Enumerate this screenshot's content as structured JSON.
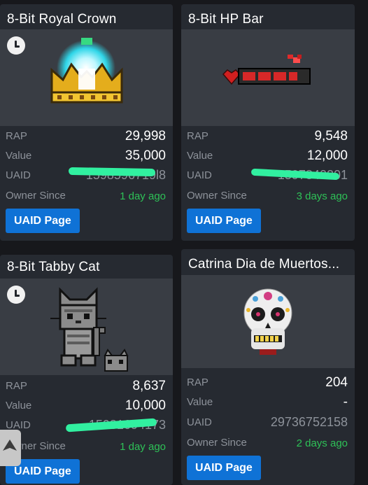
{
  "cards": [
    {
      "title": "8-Bit Royal Crown",
      "rap_label": "RAP",
      "rap": "29,998",
      "value_label": "Value",
      "value": "35,000",
      "uaid_label": "UAID",
      "uaid": "1598596719l8",
      "owner_label": "Owner Since",
      "owner_since": "1 day ago",
      "button": "UAID Page"
    },
    {
      "title": "8-Bit HP Bar",
      "rap_label": "RAP",
      "rap": "9,548",
      "value_label": "Value",
      "value": "12,000",
      "uaid_label": "UAID",
      "uaid": "1597840201",
      "owner_label": "Owner Since",
      "owner_since": "3 days ago",
      "button": "UAID Page"
    },
    {
      "title": "8-Bit Tabby Cat",
      "rap_label": "RAP",
      "rap": "8,637",
      "value_label": "Value",
      "value": "10,000",
      "uaid_label": "UAID",
      "uaid": "15981694173",
      "owner_label": "Owner Since",
      "owner_since": "1 day ago",
      "button": "UAID Page"
    },
    {
      "title": "Catrina Dia de Muertos...",
      "rap_label": "RAP",
      "rap": "204",
      "value_label": "Value",
      "value": "-",
      "uaid_label": "UAID",
      "uaid": "29736752158",
      "owner_label": "Owner Since",
      "owner_since": "2 days ago",
      "button": "UAID Page"
    }
  ],
  "colors": {
    "background": "#17181c",
    "card": "#262a31",
    "thumbnail": "#393d44",
    "button": "#0f72d6",
    "owner_since_text": "#2ec157",
    "label_text": "#8d929a",
    "scribble": "#31f0a0"
  }
}
